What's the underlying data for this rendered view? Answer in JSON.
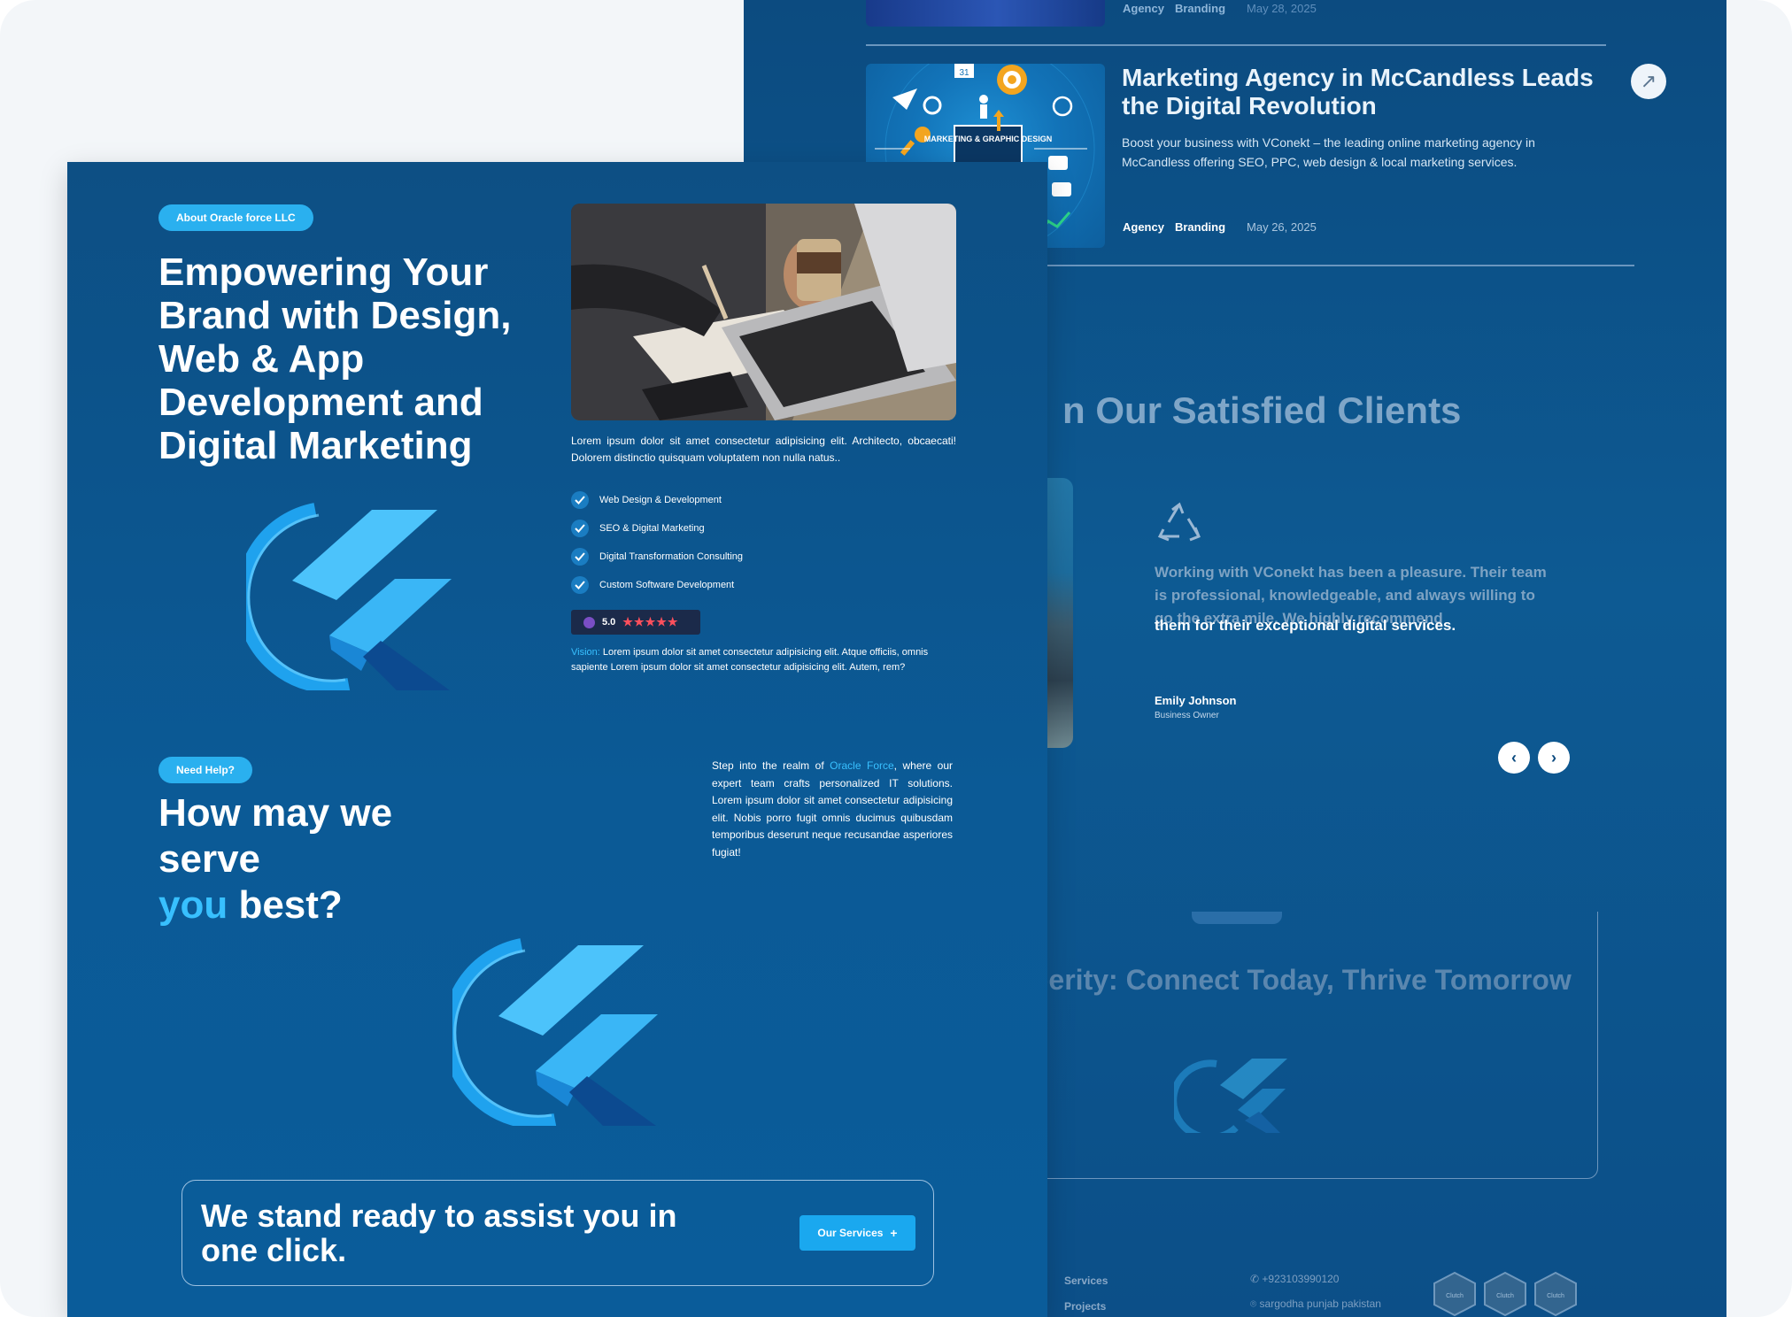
{
  "back_panel": {
    "top_post": {
      "tags": [
        "Agency",
        "Branding"
      ],
      "date": "May 28, 2025"
    },
    "post": {
      "title": "Marketing Agency in McCandless Leads the Digital Revolution",
      "description": "Boost your business with VConekt – the leading online marketing agency in McCandless offering SEO, PPC, web design & local marketing services.",
      "image_label": "MARKETING & GRAPHIC DESIGN",
      "tags": [
        "Agency",
        "Branding"
      ],
      "date": "May 26, 2025",
      "link_icon": "arrow-up-right-icon"
    },
    "clients_title": "n Our Satisfied Clients",
    "testimonial": {
      "text_faded": "Working with VConekt has been a pleasure. Their team is professional, knowledgeable, and always willing to go the extra mile. We highly recommend",
      "text_bold": "them for their exceptional digital services.",
      "author": "Emily Johnson",
      "role": "Business Owner",
      "icon": "recycle-icon",
      "prev_icon": "chevron-left-icon",
      "next_icon": "chevron-right-icon"
    },
    "cta_title": "o Prosperity: Connect Today, Thrive Tomorrow",
    "footer": {
      "links": [
        "Services",
        "Projects"
      ],
      "phone": "+923103990120",
      "address": "sargodha punjab pakistan",
      "badges": [
        "Clutch",
        "Clutch",
        "Clutch"
      ]
    }
  },
  "front_panel": {
    "about_pill": "About Oracle force LLC",
    "title": "Empowering Your Brand with Design, Web & App Development and Digital Marketing",
    "intro": "Lorem ipsum dolor sit amet consectetur adipisicing elit. Architecto, obcaecati! Dolorem distinctio quisquam voluptatem non nulla natus..",
    "services": [
      "Web Design & Development",
      "SEO & Digital Marketing",
      "Digital Transformation Consulting",
      "Custom Software Development"
    ],
    "rating": {
      "score": "5.0",
      "stars": "★★★★★"
    },
    "vision": {
      "label": "Vision:",
      "text": " Lorem ipsum dolor sit amet consectetur adipisicing elit. Atque officiis, omnis sapiente Lorem ipsum dolor sit amet consectetur adipisicing elit. Autem, rem?"
    },
    "help_pill": "Need Help?",
    "help_title_line1": "How may we serve",
    "help_title_hl": "you",
    "help_title_end": " best?",
    "paragraph": {
      "before": "Step into the realm of ",
      "brand": "Oracle Force",
      "after": ", where our expert team crafts personalized IT solutions. Lorem ipsum dolor sit amet consectetur adipisicing elit. Nobis porro fugit omnis ducimus quibusdam temporibus deserunt neque recusandae asperiores fugiat!"
    },
    "cta": {
      "text": "We stand ready to assist you in one click.",
      "button": "Our Services",
      "button_icon": "plus-icon"
    }
  },
  "colors": {
    "accent": "#2ab0ef",
    "navy": "#0c4f88",
    "highlight": "#38c0ff",
    "star": "#ff4f5c"
  }
}
